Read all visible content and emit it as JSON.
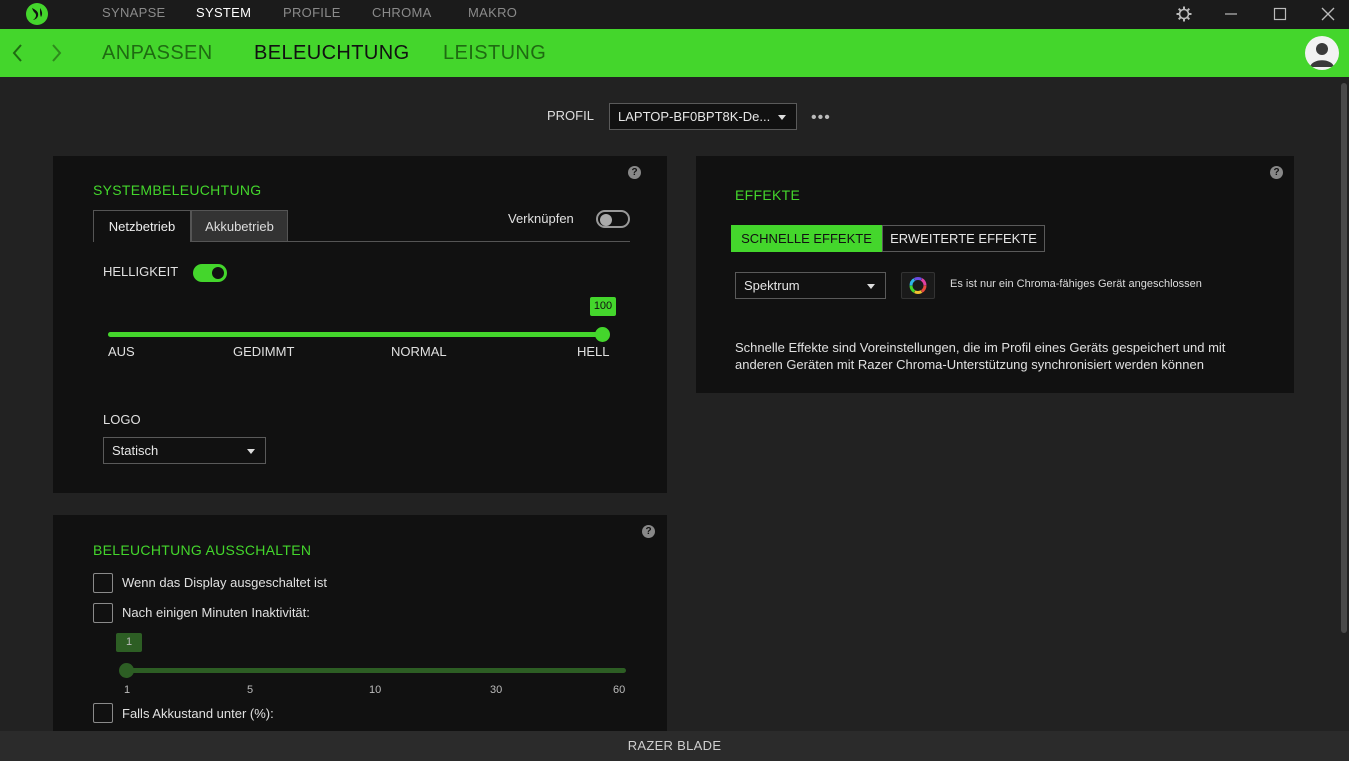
{
  "topnav": {
    "items": [
      "SYNAPSE",
      "SYSTEM",
      "PROFILE",
      "CHROMA",
      "MAKRO"
    ],
    "active": "SYSTEM"
  },
  "subnav": {
    "items": [
      "ANPASSEN",
      "BELEUCHTUNG",
      "LEISTUNG"
    ],
    "active": "BELEUCHTUNG"
  },
  "icons": {
    "logo": "razer-logo-icon",
    "settings": "gear-icon",
    "minimize": "minimize-icon",
    "maximize": "maximize-icon",
    "close": "close-icon",
    "back": "chevron-left-icon",
    "forward": "chevron-right-icon",
    "avatar": "user-avatar-icon"
  },
  "colors": {
    "accent": "#44d62c",
    "card": "#111111",
    "background": "#222222"
  },
  "profile": {
    "label": "PROFIL",
    "value": "LAPTOP-BF0BPT8K-De...",
    "more": "•••"
  },
  "system_lighting": {
    "title": "SYSTEMBELEUCHTUNG",
    "tabs": [
      "Netzbetrieb",
      "Akkubetrieb"
    ],
    "active_tab": "Netzbetrieb",
    "link_label": "Verknüpfen",
    "link_on": false,
    "brightness_label": "HELLIGKEIT",
    "brightness_on": true,
    "brightness_value": "100",
    "brightness_percent": 100,
    "slider_labels": [
      "AUS",
      "GEDIMMT",
      "NORMAL",
      "HELL"
    ],
    "logo_label": "LOGO",
    "logo_value": "Statisch"
  },
  "lighting_off": {
    "title": "BELEUCHTUNG AUSSCHALTEN",
    "options": [
      {
        "label": "Wenn das Display ausgeschaltet ist",
        "checked": false
      },
      {
        "label": "Nach einigen Minuten Inaktivität:",
        "checked": false
      },
      {
        "label": "Falls Akkustand unter (%):",
        "checked": false
      }
    ],
    "minutes_value": "1",
    "minutes_percent": 0,
    "tick_labels": [
      "1",
      "5",
      "10",
      "30",
      "60"
    ]
  },
  "effects": {
    "title": "EFFEKTE",
    "tabs": [
      "SCHNELLE EFFEKTE",
      "ERWEITERTE EFFEKTE"
    ],
    "active_tab": "SCHNELLE EFFEKTE",
    "effect_value": "Spektrum",
    "chroma_icon": "chroma-rainbow-icon",
    "device_note": "Es ist nur ein Chroma-fähiges Gerät angeschlossen",
    "description_line1": "Schnelle Effekte sind Voreinstellungen, die im Profil eines Geräts gespeichert und mit",
    "description_line2": "anderen Geräten mit Razer Chroma-Unterstützung synchronisiert werden können"
  },
  "help": "?",
  "status": {
    "device": "RAZER BLADE"
  }
}
